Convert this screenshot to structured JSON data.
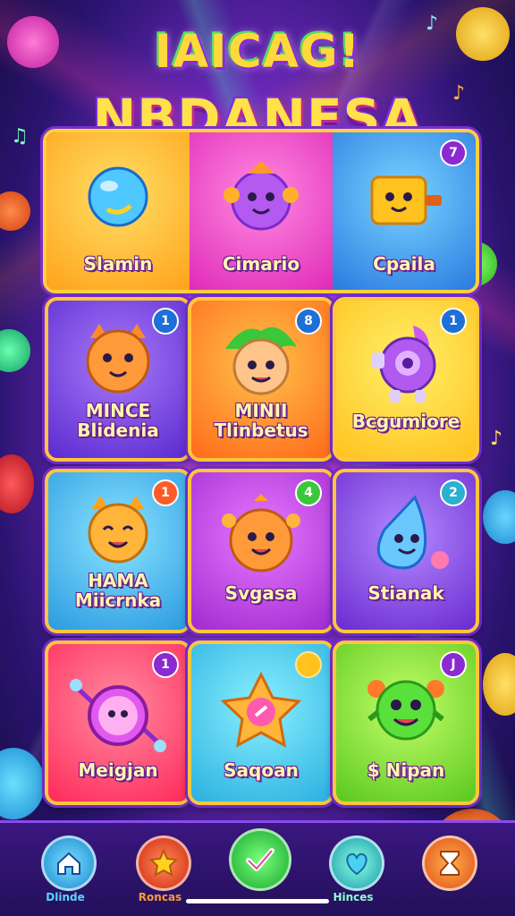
{
  "title": {
    "line1": "IAICAG!",
    "line2": "NBDANESA"
  },
  "banner": {
    "items": [
      {
        "label": "Slamin",
        "icon": "blue-balloon-icon",
        "color": "#ffb21e"
      },
      {
        "label": "Cimario",
        "icon": "purple-blob-character-icon",
        "color": "#f049c6"
      },
      {
        "label": "Cpaila",
        "icon": "yellow-block-character-icon",
        "color": "#3aa7ff",
        "badge": "7"
      }
    ]
  },
  "cards": [
    {
      "label": "MINCE\nBlidenia",
      "badge": "1",
      "icon": "orange-cat-icon",
      "color": "#7b4cf0"
    },
    {
      "label": "MINII\nTlinbetus",
      "badge": "8",
      "icon": "leaf-hair-kid-icon",
      "color": "#ff8c1a"
    },
    {
      "label": "Bcgumiore",
      "badge": "1",
      "icon": "purple-robot-icon",
      "color": "#ffd21e"
    },
    {
      "label": "HAMA\nMiicrnka",
      "badge": "1",
      "icon": "yellow-cat-icon",
      "color": "#38b8ea"
    },
    {
      "label": "Svgasa",
      "badge": "4",
      "icon": "orange-girl-icon",
      "color": "#c13fe0"
    },
    {
      "label": "Stianak",
      "badge": "2",
      "icon": "blue-drop-character-icon",
      "color": "#8a4af0"
    },
    {
      "label": "Meigjan",
      "badge": "1",
      "icon": "pink-orb-icon",
      "color": "#ff3c7a"
    },
    {
      "label": "Saqoan",
      "badge": "",
      "icon": "star-badge-icon",
      "color": "#3ec4f0"
    },
    {
      "label": "$ Nipan",
      "badge": "J",
      "icon": "green-monster-icon",
      "color": "#7fd42a"
    }
  ],
  "nav": [
    {
      "label": "Dlinde",
      "icon": "home-icon",
      "color": "#38c4f0",
      "label_color": "#5ad4ff"
    },
    {
      "label": "Roncas",
      "icon": "star-icon",
      "color": "#ff4a2a",
      "label_color": "#ff9a3a"
    },
    {
      "label": "",
      "icon": "checkmark-icon",
      "color": "#2ad14a",
      "label_color": "#7fff7a"
    },
    {
      "label": "Hinces",
      "icon": "heart-icon",
      "color": "#2ab8d8",
      "label_color": "#8affd0"
    },
    {
      "label": "",
      "icon": "hourglass-icon",
      "color": "#ff6a1a",
      "label_color": "#ffb04a"
    }
  ]
}
